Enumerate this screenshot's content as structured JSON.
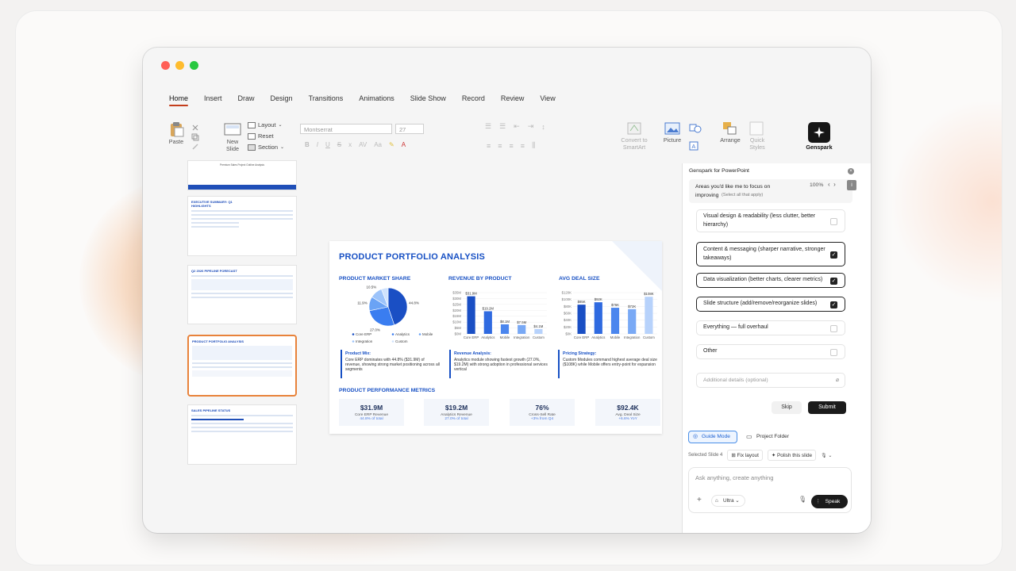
{
  "window_controls": {
    "colors": [
      "#ff5f57",
      "#febc2e",
      "#28c840"
    ]
  },
  "tabs": [
    "Home",
    "Insert",
    "Draw",
    "Design",
    "Transitions",
    "Animations",
    "Slide Show",
    "Record",
    "Review",
    "View"
  ],
  "active_tab": "Home",
  "ribbon": {
    "paste": "Paste",
    "new_slide": "New\nSlide",
    "layout": "Layout",
    "reset": "Reset",
    "section": "Section",
    "font": "Montserrat",
    "font_size": "27",
    "convert_smartart": "Convert to\nSmartArt",
    "picture": "Picture",
    "arrange": "Arrange",
    "quick_styles": "Quick\nStyles",
    "genspark": "Genspark"
  },
  "thumbnails": [
    {
      "title": "Premium Sales Project Outline Analysis"
    },
    {
      "title": "EXECUTIVE SUMMARY: Q1 HIGHLIGHTS"
    },
    {
      "title": "Q2 2026 PIPELINE FORECAST"
    },
    {
      "title": "PRODUCT PORTFOLIO ANALYSIS"
    },
    {
      "title": "SALES PIPELINE STATUS"
    }
  ],
  "slide": {
    "title": "PRODUCT PORTFOLIO ANALYSIS",
    "sections": {
      "market_share": "PRODUCT MARKET SHARE",
      "revenue": "REVENUE BY PRODUCT",
      "deal_size": "AVG DEAL SIZE",
      "metrics": "PRODUCT PERFORMANCE METRICS"
    },
    "insights": [
      {
        "title": "Product Mix:",
        "text": "Core ERP dominates with 44.8% ($31.9M) of revenue, showing strong market positioning across all segments"
      },
      {
        "title": "Revenue Analysis:",
        "text": "Analytics module showing fastest growth (27.0%, $19.2M) with strong adoption in professional services vertical"
      },
      {
        "title": "Pricing Strategy:",
        "text": "Custom Modules command highest average deal size ($108K) while Mobile offers entry-point for expansion"
      }
    ],
    "metrics": [
      {
        "value": "$31.9M",
        "label": "Core ERP Revenue",
        "sub": "44.8% of total"
      },
      {
        "value": "$19.2M",
        "label": "Analytics Revenue",
        "sub": "27.0% of total"
      },
      {
        "value": "76%",
        "label": "Cross-Sell Rate",
        "sub": "+3% from Q4"
      },
      {
        "value": "$92.4K",
        "label": "Avg. Deal Size",
        "sub": "+6.6% YoY"
      }
    ]
  },
  "chart_data": [
    {
      "type": "pie",
      "title": "PRODUCT MARKET SHARE",
      "categories": [
        "Core ERP",
        "Analytics",
        "Mobile",
        "Integration",
        "Custom"
      ],
      "values": [
        44.8,
        27.0,
        11.9,
        10.5,
        5.8
      ],
      "colors": [
        "#1a4fc4",
        "#3a7df0",
        "#6aa3f5",
        "#9cc3fa",
        "#cfe2fd"
      ],
      "legend": "bottom"
    },
    {
      "type": "bar",
      "title": "REVENUE BY PRODUCT",
      "categories": [
        "Core ERP",
        "Analytics",
        "Mobile",
        "Integration",
        "Custom"
      ],
      "values": [
        31.9,
        19.2,
        8.1,
        7.5,
        4.1
      ],
      "labels": [
        "$31.9M",
        "$19.2M",
        "$8.1M",
        "$7.5M",
        "$4.1M"
      ],
      "y_ticks": [
        "$35M",
        "$30M",
        "$25M",
        "$20M",
        "$15M",
        "$10M",
        "$5M",
        "$0M"
      ],
      "ylim": [
        0,
        35
      ]
    },
    {
      "type": "bar",
      "title": "AVG DEAL SIZE",
      "categories": [
        "Core ERP",
        "Analytics",
        "Mobile",
        "Integration",
        "Custom"
      ],
      "values": [
        85,
        92,
        76,
        72,
        108
      ],
      "labels": [
        "$85K",
        "$92K",
        "$76K",
        "$72K",
        "$108K"
      ],
      "y_ticks": [
        "$120K",
        "$100K",
        "$80K",
        "$60K",
        "$40K",
        "$20K",
        "$0K"
      ],
      "ylim": [
        0,
        120
      ]
    }
  ],
  "panel": {
    "title": "Genspark for PowerPoint",
    "question": "Areas you'd like me to focus on improving",
    "question_hint": "(Select all that apply)",
    "progress": "100%",
    "options": [
      {
        "label": "Visual design & readability (less clutter, better hierarchy)",
        "checked": false
      },
      {
        "label": "Content & messaging (sharper narrative, stronger takeaways)",
        "checked": true
      },
      {
        "label": "Data visualization (better charts, clearer metrics)",
        "checked": true
      },
      {
        "label": "Slide structure (add/remove/reorganize slides)",
        "checked": true
      },
      {
        "label": "Everything — full overhaul",
        "checked": false
      },
      {
        "label": "Other",
        "checked": false
      }
    ],
    "additional_placeholder": "Additional details (optional)",
    "skip": "Skip",
    "submit": "Submit",
    "guide_mode": "Guide Mode",
    "project_folder": "Project Folder",
    "selected_slide": "Selected Slide 4",
    "fix_layout": "Fix layout",
    "polish_slide": "Polish this slide",
    "ask_placeholder": "Ask anything, create anything",
    "model": "Ultra",
    "speak": "Speak"
  }
}
